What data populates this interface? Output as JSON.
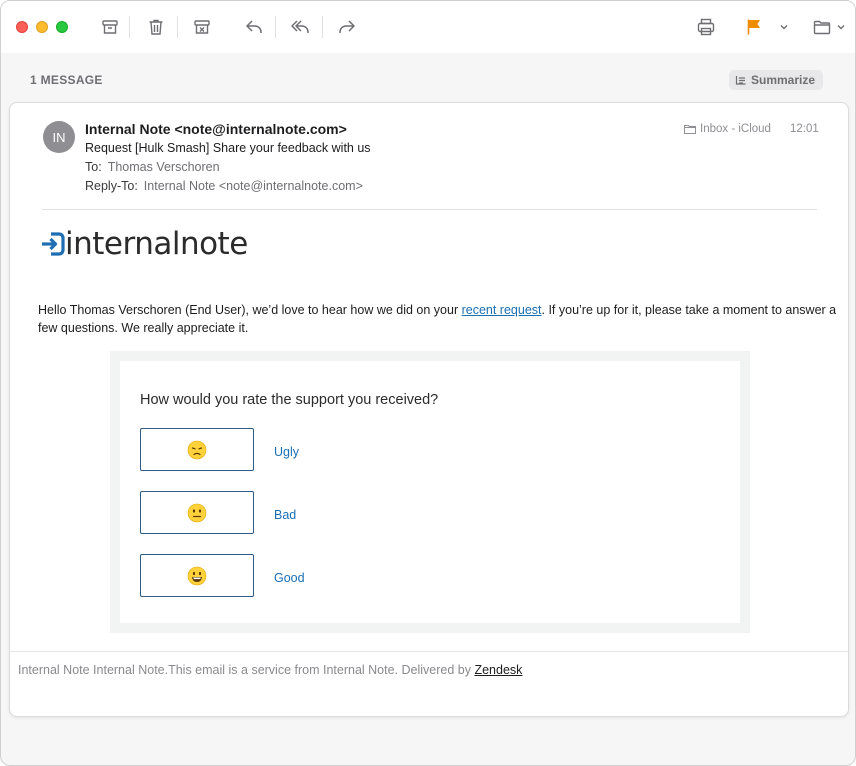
{
  "toolbar": {
    "icons": [
      "archive-icon",
      "trash-icon",
      "junk-icon",
      "reply-icon",
      "reply-all-icon",
      "forward-icon",
      "print-icon",
      "flag-icon",
      "move-to-folder-icon"
    ],
    "flag_color": "#f08c00"
  },
  "thread": {
    "count_label": "1 MESSAGE",
    "summarize_label": "Summarize"
  },
  "message": {
    "avatar_initials": "IN",
    "from": "Internal Note <note@internalnote.com>",
    "subject": "Request [Hulk Smash] Share your feedback with us",
    "to_label": "To:",
    "to_value": "Thomas Verschoren",
    "reply_to_label": "Reply-To:",
    "reply_to_value": "Internal Note <note@internalnote.com>",
    "mailbox": "Inbox - iCloud",
    "time": "12:01"
  },
  "email": {
    "logo_text": "internalnote",
    "logo_color": "#1f6db2",
    "intro_before_link": "Hello Thomas Verschoren (End User), we’d love to hear how we did on your ",
    "link_text": "recent request",
    "intro_after_link": ". If you’re up for it, please take a moment to answer a few questions. We really appreciate it.",
    "question": "How would you rate the support you received?",
    "ratings": [
      {
        "label": "Ugly",
        "icon": "sad-face-icon"
      },
      {
        "label": "Bad",
        "icon": "neutral-face-icon"
      },
      {
        "label": "Good",
        "icon": "smile-face-icon"
      }
    ],
    "footer_text": "Internal Note Internal Note.This email is a service from Internal Note. Delivered by ",
    "footer_link": "Zendesk"
  }
}
